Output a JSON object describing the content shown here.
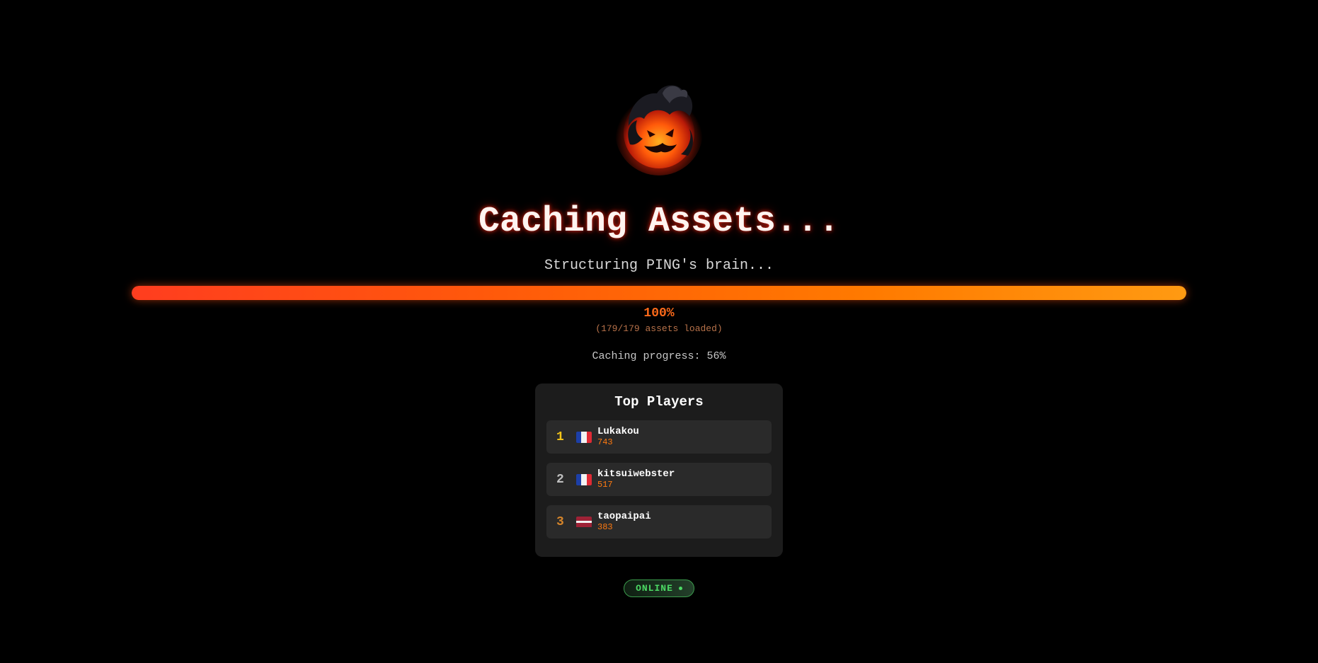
{
  "loader": {
    "title": "Caching Assets...",
    "subtitle": "Structuring PING's brain...",
    "progress_fraction": 1.0,
    "percent_label": "100%",
    "assets_loaded": "(179/179 assets loaded)",
    "caching_progress": "Caching progress: 56%",
    "logo_icon": "flaming-ball-icon"
  },
  "leaderboard": {
    "title": "Top Players",
    "players": [
      {
        "rank": "1",
        "flag": "france-flag-icon",
        "name": "Lukakou",
        "score": "743",
        "rank_color": "#f5c518"
      },
      {
        "rank": "2",
        "flag": "france-flag-icon",
        "name": "kitsuiwebster",
        "score": "517",
        "rank_color": "#c0c0c0"
      },
      {
        "rank": "3",
        "flag": "latvia-flag-icon",
        "name": "taopaipai",
        "score": "383",
        "rank_color": "#d4842a"
      }
    ]
  },
  "status": {
    "label": "ONLINE",
    "color": "#4cd964"
  },
  "colors": {
    "accent": "#ff6a1a",
    "background": "#000000"
  }
}
